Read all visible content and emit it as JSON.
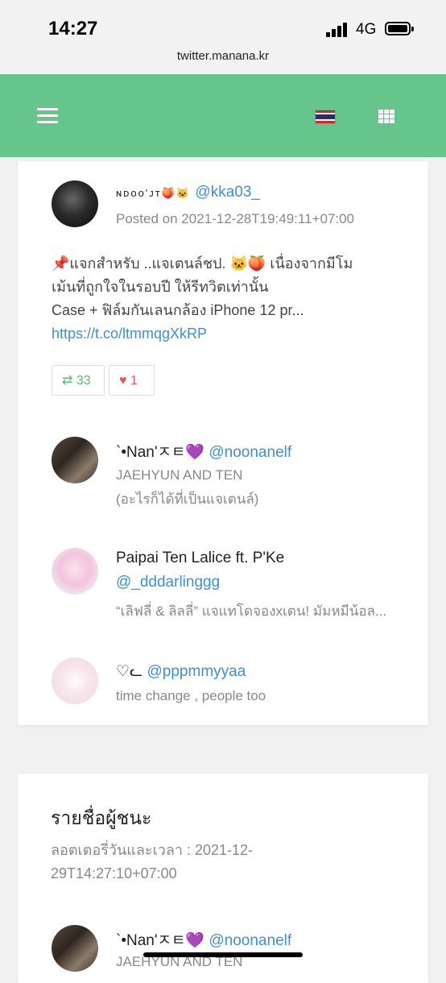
{
  "status_bar": {
    "time": "14:27",
    "network": "4G"
  },
  "browser": {
    "url": "twitter.manana.kr"
  },
  "navbar": {
    "flag": "Thailand flag",
    "menu_icon": "hamburger-icon",
    "apps_icon": "grid-icon"
  },
  "tweet": {
    "user_name": "ɴᴅᴏᴏ'ᴊᴛ🍑🐱",
    "handle": "@kka03_",
    "posted": "Posted on 2021-12-28T19:49:11+07:00",
    "text_line1": "📌แจกสำหรับ ..แจเตนล์ชป. 🐱🍑 เนื่องจากมีโม",
    "text_line2": "เม้นที่ถูกใจในรอบปี ให้รีทวิตเท่านั้น",
    "text_line3": "Case + ฟิล์มกันเลนกล้อง iPhone 12 pr...",
    "link": "https://t.co/ltmmqgXkRP",
    "retweet_count": "33",
    "like_count": "1"
  },
  "replies": [
    {
      "name": "`•Nan'ㅈㅌ💜",
      "handle": "@noonanelf",
      "line1": "JAEHYUN AND TEN",
      "line2": "(อะไรก็ได้ที่เป็นแจเตนล์)"
    },
    {
      "name": "Paipai Ten Lalice ft. P'Ke",
      "handle": "@_dddarlinggg",
      "line1": "“เลิฟลี่ & ลิลลี่” แจแทโดจองxเตน! มัมหมีน้อล..."
    },
    {
      "name": "♡ᓚ",
      "handle": "@pppmmyyaa",
      "line1": "time change , people too"
    }
  ],
  "winners": {
    "title": "รายชื่อผู้ชนะ",
    "lottery_line1": "ลอตเตอรี่วันและเวลา : 2021-12-",
    "lottery_line2": "29T14:27:10+07:00",
    "first": {
      "name": "`•Nan'ㅈㅌ💜",
      "handle": "@noonanelf",
      "line1": "JAEHYUN AND TEN"
    }
  },
  "colors": {
    "navbar": "#66c58b",
    "link": "#3d8fd6",
    "retweet": "#5cb97c",
    "like": "#e05a5a"
  }
}
